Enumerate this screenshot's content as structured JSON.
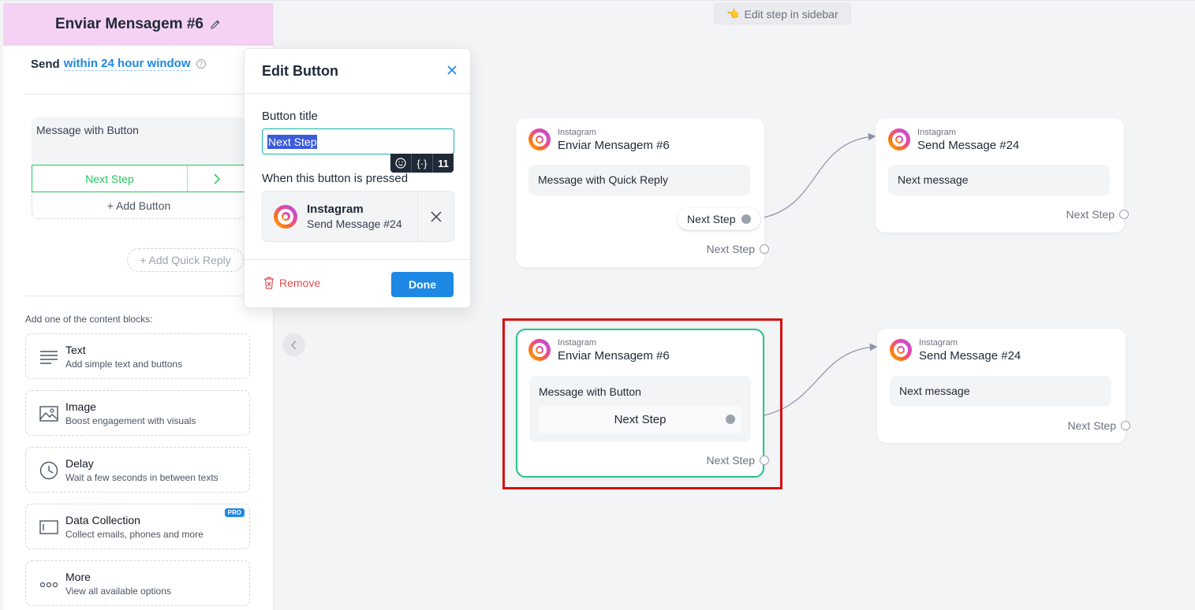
{
  "canvas": {
    "hint_text": "Edit step in sidebar"
  },
  "sidebar": {
    "title": "Enviar Mensagem #6",
    "send_label": "Send",
    "send_window": "within 24 hour window",
    "message_block_label": "Message with Button",
    "button_label": "Next Step",
    "add_button_label": "+ Add Button",
    "add_quick_reply_label": "+ Add Quick Reply",
    "content_blocks_label": "Add one of the content blocks:",
    "blocks": [
      {
        "title": "Text",
        "desc": "Add simple text and buttons",
        "icon": "text-lines-icon"
      },
      {
        "title": "Image",
        "desc": "Boost engagement with visuals",
        "icon": "image-icon"
      },
      {
        "title": "Delay",
        "desc": "Wait a few seconds in between texts",
        "icon": "clock-icon"
      },
      {
        "title": "Data Collection",
        "desc": "Collect emails, phones and more",
        "icon": "input-field-icon",
        "badge": "PRO"
      },
      {
        "title": "More",
        "desc": "View all available options",
        "icon": "more-dots-icon"
      }
    ]
  },
  "popup": {
    "title": "Edit Button",
    "button_title_label": "Button title",
    "button_title_value": "Next Step",
    "char_count": "11",
    "when_pressed_label": "When this button is pressed",
    "target_platform": "Instagram",
    "target_step": "Send Message #24",
    "remove_label": "Remove",
    "done_label": "Done"
  },
  "flow": {
    "cards": [
      {
        "platform": "Instagram",
        "name": "Enviar Mensagem #6",
        "message": "Message with Quick Reply",
        "quick_reply": "Next Step",
        "next_label": "Next Step"
      },
      {
        "platform": "Instagram",
        "name": "Send Message #24",
        "message": "Next message",
        "next_label": "Next Step"
      },
      {
        "platform": "Instagram",
        "name": "Enviar Mensagem #6",
        "message": "Message with Button",
        "button": "Next Step",
        "next_label": "Next Step"
      },
      {
        "platform": "Instagram",
        "name": "Send Message #24",
        "message": "Next message",
        "next_label": "Next Step"
      }
    ]
  },
  "colors": {
    "accent_blue": "#1e88e5",
    "accent_green": "#22c55e",
    "header_pink": "#f5d2f3",
    "remove_red": "#e34d4d",
    "highlight_red": "#d90f0f"
  }
}
